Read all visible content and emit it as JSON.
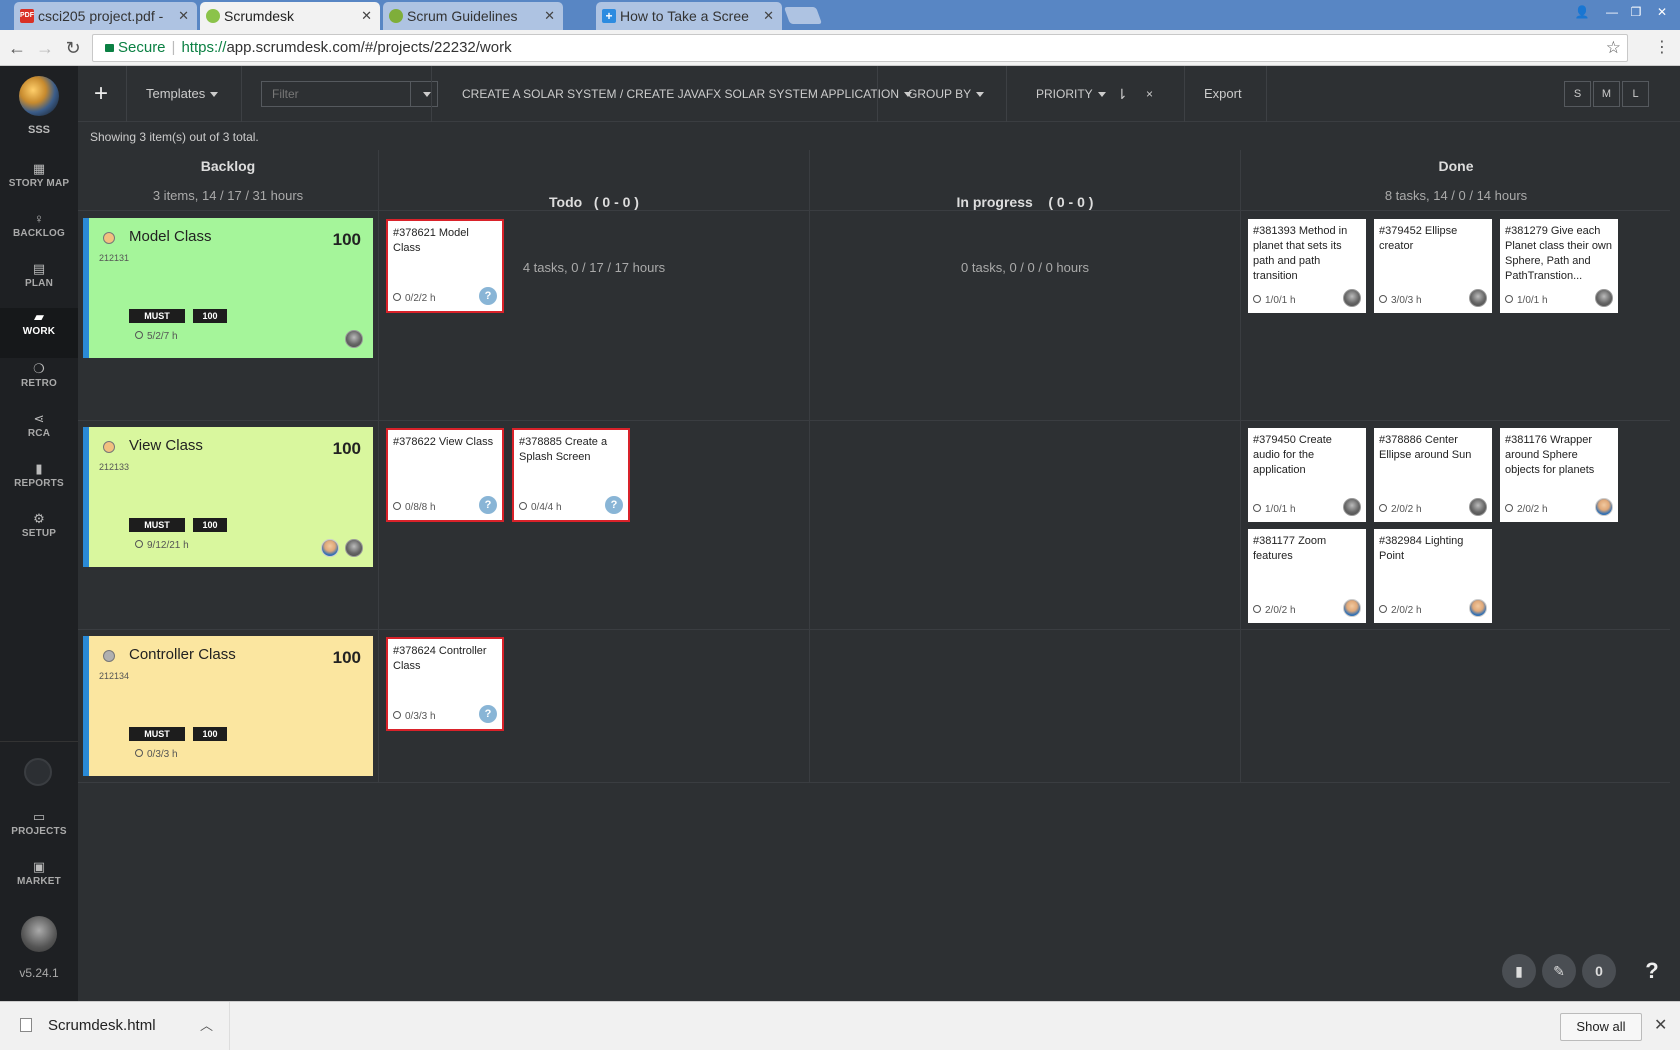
{
  "browser": {
    "tabs": [
      {
        "title": "csci205 project.pdf -",
        "favicon": "PDF",
        "favicon_color": "#d93025"
      },
      {
        "title": "Scrumdesk",
        "favicon": "",
        "favicon_color": "#8bc34a"
      },
      {
        "title": "Scrum Guidelines",
        "favicon": "",
        "favicon_color": "#7fae3a"
      },
      {
        "title": "How to Take a Scree",
        "favicon": "+",
        "favicon_color": "#2c8be0"
      }
    ],
    "tab_close": "✕",
    "window_controls": {
      "user": "👤",
      "minimize": "—",
      "restore": "❐",
      "close": "✕"
    },
    "secure_label": "Secure",
    "url_scheme": "https://",
    "url_rest": "app.scrumdesk.com/#/projects/22232/work"
  },
  "sidebar": {
    "project_code": "SSS",
    "items": [
      {
        "label": "STORY MAP",
        "icon": "▦"
      },
      {
        "label": "BACKLOG",
        "icon": "♀"
      },
      {
        "label": "PLAN",
        "icon": "▤"
      },
      {
        "label": "WORK",
        "icon": "▰"
      },
      {
        "label": "RETRO",
        "icon": "❍"
      },
      {
        "label": "RCA",
        "icon": "⋖"
      },
      {
        "label": "REPORTS",
        "icon": "▮"
      },
      {
        "label": "SETUP",
        "icon": "⚙"
      },
      {
        "label": "PROJECTS",
        "icon": "▭"
      },
      {
        "label": "MARKET",
        "icon": "▣"
      }
    ],
    "version": "v5.24.1"
  },
  "toolbar": {
    "add": "+",
    "templates": "Templates",
    "filter_placeholder": "Filter",
    "breadcrumb": "CREATE A SOLAR SYSTEM / CREATE JAVAFX SOLAR SYSTEM APPLICATION",
    "group_by": "GROUP BY",
    "priority": "PRIORITY",
    "sort_icon": "⇂",
    "clear": "×",
    "export": "Export",
    "sizes": [
      "S",
      "M",
      "L"
    ]
  },
  "board": {
    "showing": "Showing 3 item(s) out of 3 total.",
    "columns": [
      {
        "title": "Backlog",
        "summary": "3 items, 14 / 17 / 31 hours"
      },
      {
        "title": "Todo   ( 0 - 0 )",
        "summary": "4 tasks, 0 / 17 / 17 hours"
      },
      {
        "title": "In progress    ( 0 - 0 )",
        "summary": "0 tasks, 0 / 0 / 0 hours"
      },
      {
        "title": "Done",
        "summary": "8 tasks, 14 / 0 / 14 hours"
      }
    ],
    "stories": [
      {
        "name": "Model Class",
        "id": "212131",
        "value": "100",
        "must": "MUST",
        "badge": "100",
        "hours": "5/2/7 h",
        "color": "#a5f59a",
        "dot": "#f2c07f"
      },
      {
        "name": "View Class",
        "id": "212133",
        "value": "100",
        "must": "MUST",
        "badge": "100",
        "hours": "9/12/21 h",
        "color": "#d9f79e",
        "dot": "#f2c07f"
      },
      {
        "name": "Controller Class",
        "id": "212134",
        "value": "100",
        "must": "MUST",
        "badge": "100",
        "hours": "0/3/3 h",
        "color": "#fbe6a0",
        "dot": "#b0b0b0"
      }
    ],
    "todo": [
      {
        "title": "#378621 Model Class",
        "hours": "0/2/2 h"
      },
      {
        "title": "#378622 View Class",
        "hours": "0/8/8 h"
      },
      {
        "title": "#378885 Create a Splash Screen",
        "hours": "0/4/4 h"
      },
      {
        "title": "#378624 Controller Class",
        "hours": "0/3/3 h"
      }
    ],
    "done": [
      {
        "title": "#381393 Method in planet that sets its path and path transition",
        "hours": "1/0/1 h"
      },
      {
        "title": "#379452 Ellipse creator",
        "hours": "3/0/3 h"
      },
      {
        "title": "#381279 Give each Planet class their own Sphere, Path and PathTranstion...",
        "hours": "1/0/1 h"
      },
      {
        "title": "#379450 Create audio for the application",
        "hours": "1/0/1 h"
      },
      {
        "title": "#378886 Center Ellipse around Sun",
        "hours": "2/0/2 h"
      },
      {
        "title": "#381176 Wrapper around Sphere objects for planets",
        "hours": "2/0/2 h"
      },
      {
        "title": "#381177 Zoom features",
        "hours": "2/0/2 h"
      },
      {
        "title": "#382984 Lighting Point",
        "hours": "2/0/2 h"
      }
    ],
    "unknown_avatar": "?"
  },
  "fab": {
    "counter": "0",
    "help": "?"
  },
  "downloads": {
    "file": "Scrumdesk.html",
    "show_all": "Show all"
  }
}
